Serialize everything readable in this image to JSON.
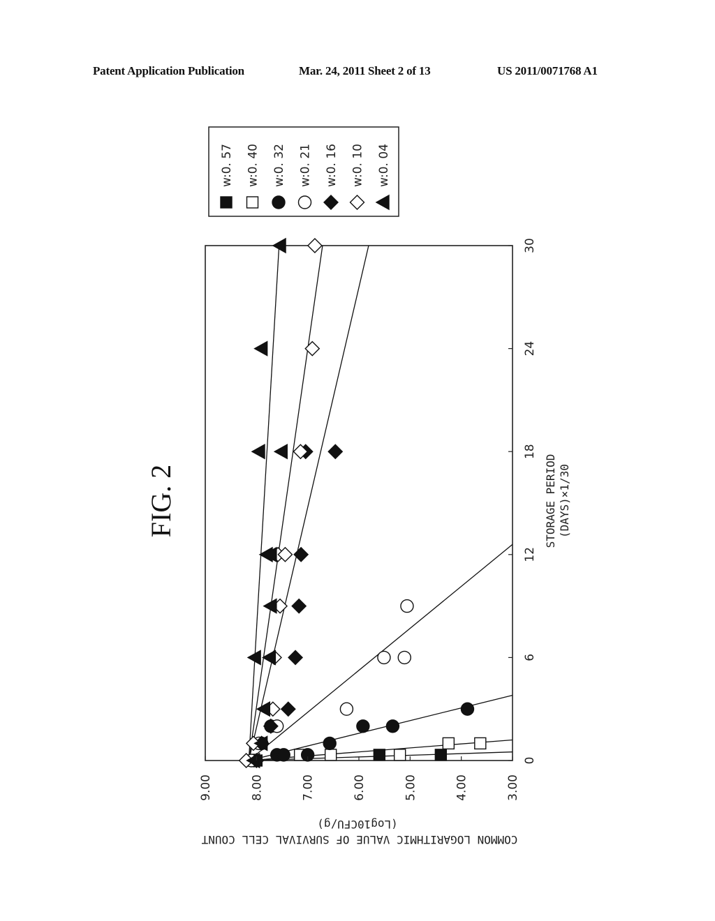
{
  "header": {
    "left": "Patent Application Publication",
    "middle": "Mar. 24, 2011  Sheet 2 of 13",
    "right": "US 2011/0071768 A1"
  },
  "figure": {
    "title": "FIG. 2",
    "orientation": "rotated 90 degrees (landscape figure printed sideways)"
  },
  "chart_data": {
    "type": "scatter",
    "title": "FIG. 2",
    "xlabel": "STORAGE PERIOD (DAYS)×1/30",
    "xlabel_line1": "STORAGE PERIOD",
    "xlabel_line2": "(DAYS)×1/30",
    "ylabel": "COMMON LOGARITHMIC VALUE OF SURVIVAL CELL COUNT (Log10CFU/g)",
    "ylabel_line1": "COMMON LOGARITHMIC VALUE OF SURVIVAL CELL COUNT",
    "ylabel_line2": "(Log10CFU/g)",
    "xlim": [
      0,
      30
    ],
    "ylim": [
      3.0,
      9.0
    ],
    "xticks": [
      "0",
      "6",
      "12",
      "18",
      "24",
      "30"
    ],
    "xtick_values": [
      0,
      6,
      12,
      18,
      24,
      30
    ],
    "yticks": [
      "9.00",
      "8.00",
      "7.00",
      "6.00",
      "5.00",
      "4.00",
      "3.00"
    ],
    "ytick_values": [
      9,
      8,
      7,
      6,
      5,
      4,
      3
    ],
    "grid": false,
    "legend_position": "top-right",
    "series": [
      {
        "name": "w:0.57",
        "marker": "filled-square",
        "points": [
          [
            0,
            8.0
          ],
          [
            0.33,
            5.6
          ],
          [
            0.33,
            4.4
          ]
        ],
        "fit": {
          "intercept": 8.15,
          "slope": -10.3
        }
      },
      {
        "name": "w:0.40",
        "marker": "open-square",
        "points": [
          [
            0,
            8.1
          ],
          [
            0.33,
            7.15
          ],
          [
            0.33,
            6.55
          ],
          [
            0.33,
            5.2
          ],
          [
            1,
            4.25
          ],
          [
            1,
            3.63
          ]
        ],
        "fit": {
          "intercept": 8.15,
          "slope": -4.29
        }
      },
      {
        "name": "w:0.32",
        "marker": "filled-circle",
        "points": [
          [
            0,
            8.05
          ],
          [
            0.33,
            7.6
          ],
          [
            0.33,
            7.47
          ],
          [
            0.33,
            7.0
          ],
          [
            1,
            7.9
          ],
          [
            1,
            6.57
          ],
          [
            2,
            7.72
          ],
          [
            2,
            5.92
          ],
          [
            2,
            5.34
          ],
          [
            3,
            3.88
          ]
        ],
        "fit": {
          "intercept": 8.15,
          "slope": -1.355
        }
      },
      {
        "name": "w:0.21",
        "marker": "open-circle",
        "points": [
          [
            0,
            8.1
          ],
          [
            1,
            7.95
          ],
          [
            2,
            7.6
          ],
          [
            3,
            6.24
          ],
          [
            6,
            5.51
          ],
          [
            6,
            5.11
          ],
          [
            9,
            5.06
          ]
        ],
        "fit": {
          "intercept": 8.15,
          "slope": -0.409
        }
      },
      {
        "name": "w:0.16",
        "marker": "filled-diamond",
        "points": [
          [
            0,
            8.0
          ],
          [
            1,
            7.9
          ],
          [
            2,
            7.72
          ],
          [
            3,
            7.38
          ],
          [
            6,
            7.24
          ],
          [
            9,
            7.17
          ],
          [
            12,
            7.13
          ],
          [
            18,
            7.04
          ],
          [
            18,
            6.46
          ]
        ],
        "fit": {
          "intercept": 8.15,
          "slope": -0.078
        }
      },
      {
        "name": "w:0.10",
        "marker": "open-diamond",
        "points": [
          [
            0,
            8.2
          ],
          [
            1,
            8.06
          ],
          [
            3,
            7.68
          ],
          [
            6,
            7.65
          ],
          [
            9,
            7.54
          ],
          [
            12,
            7.58
          ],
          [
            12,
            7.44
          ],
          [
            18,
            7.14
          ],
          [
            24,
            6.91
          ],
          [
            30,
            6.86
          ]
        ],
        "fit": {
          "intercept": 8.15,
          "slope": -0.048
        }
      },
      {
        "name": "w:0.04",
        "marker": "filled-triangle",
        "points": [
          [
            0,
            8.05
          ],
          [
            1,
            7.9
          ],
          [
            3,
            7.85
          ],
          [
            6,
            8.03
          ],
          [
            6,
            7.74
          ],
          [
            9,
            7.72
          ],
          [
            12,
            7.8
          ],
          [
            12,
            7.72
          ],
          [
            18,
            7.95
          ],
          [
            18,
            7.51
          ],
          [
            24,
            7.9
          ],
          [
            30,
            7.54
          ]
        ],
        "fit": {
          "intercept": 8.15,
          "slope": -0.0197
        }
      }
    ]
  }
}
